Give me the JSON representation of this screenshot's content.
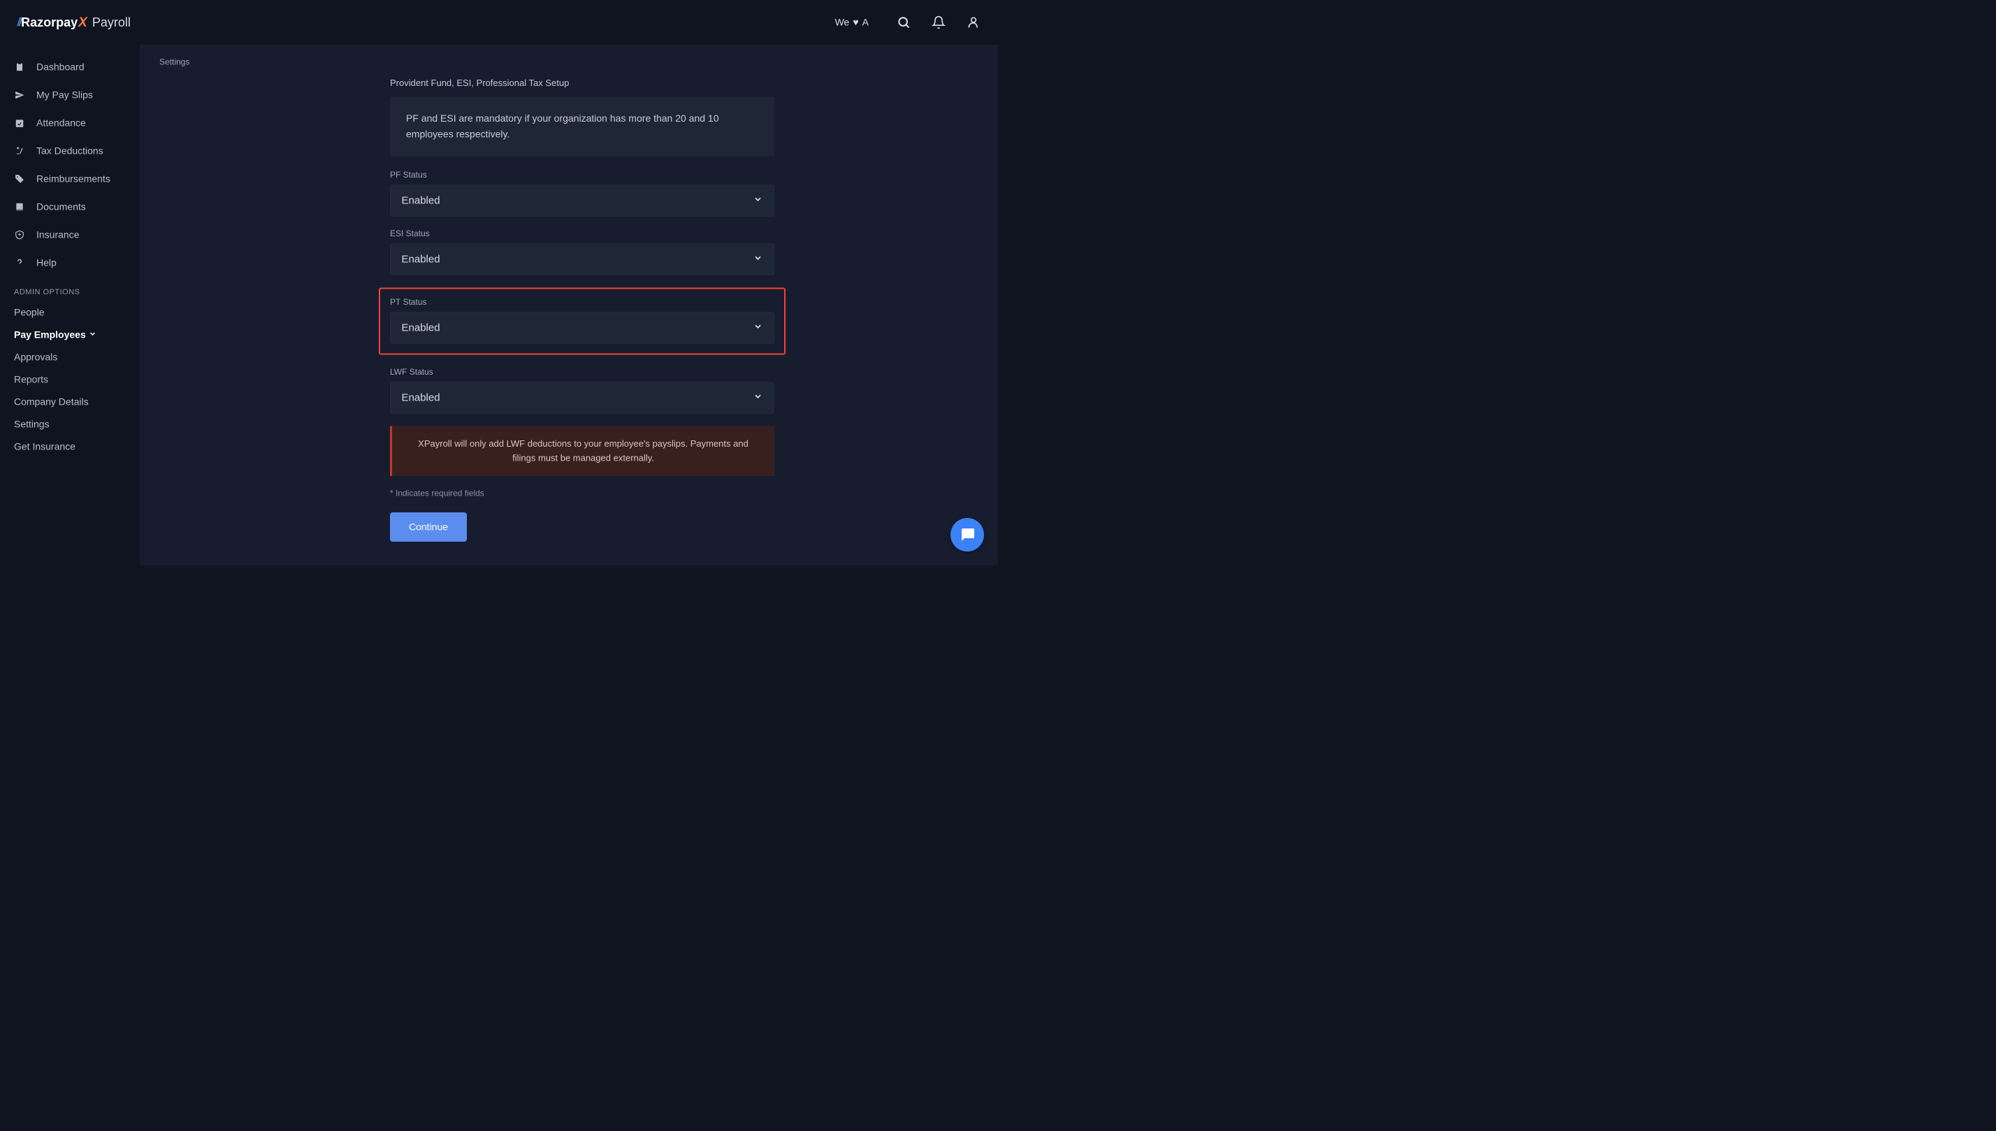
{
  "header": {
    "logo_brand": "Razorpay",
    "logo_product": "Payroll",
    "tagline_prefix": "We",
    "tagline_suffix": "A"
  },
  "sidebar": {
    "items": [
      {
        "label": "Dashboard"
      },
      {
        "label": "My Pay Slips"
      },
      {
        "label": "Attendance"
      },
      {
        "label": "Tax Deductions"
      },
      {
        "label": "Reimbursements"
      },
      {
        "label": "Documents"
      },
      {
        "label": "Insurance"
      },
      {
        "label": "Help"
      }
    ],
    "admin_label": "ADMIN OPTIONS",
    "admin_items": [
      {
        "label": "People"
      },
      {
        "label": "Pay Employees",
        "bold": true,
        "has_chevron": true
      },
      {
        "label": "Approvals"
      },
      {
        "label": "Reports"
      },
      {
        "label": "Company Details"
      },
      {
        "label": "Settings"
      },
      {
        "label": "Get Insurance"
      }
    ]
  },
  "main": {
    "breadcrumb": "Settings",
    "section_title": "Provident Fund, ESI, Professional Tax Setup",
    "info_text": "PF and ESI are mandatory if your organization has more than 20 and 10 employees respectively.",
    "fields": {
      "pf": {
        "label": "PF Status",
        "value": "Enabled"
      },
      "esi": {
        "label": "ESI Status",
        "value": "Enabled"
      },
      "pt": {
        "label": "PT Status",
        "value": "Enabled",
        "highlighted": true
      },
      "lwf": {
        "label": "LWF Status",
        "value": "Enabled"
      }
    },
    "warning_text": "XPayroll will only add LWF deductions to your employee's payslips. Payments and filings must be managed externally.",
    "required_note": "* Indicates required fields",
    "continue_label": "Continue"
  }
}
